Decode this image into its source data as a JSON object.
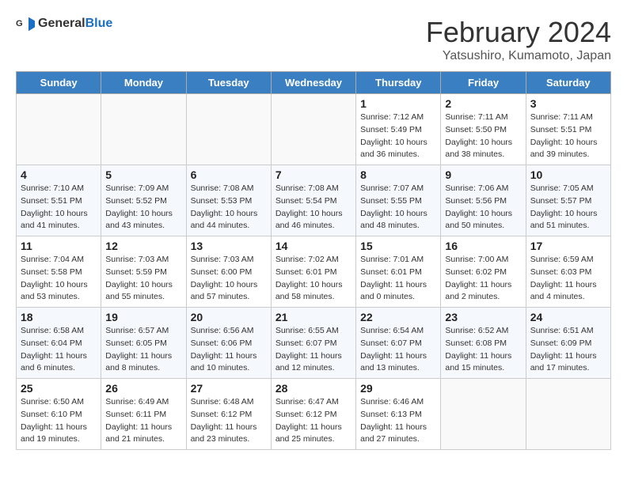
{
  "header": {
    "logo_general": "General",
    "logo_blue": "Blue",
    "title": "February 2024",
    "location": "Yatsushiro, Kumamoto, Japan"
  },
  "weekdays": [
    "Sunday",
    "Monday",
    "Tuesday",
    "Wednesday",
    "Thursday",
    "Friday",
    "Saturday"
  ],
  "weeks": [
    [
      {
        "day": "",
        "info": ""
      },
      {
        "day": "",
        "info": ""
      },
      {
        "day": "",
        "info": ""
      },
      {
        "day": "",
        "info": ""
      },
      {
        "day": "1",
        "info": "Sunrise: 7:12 AM\nSunset: 5:49 PM\nDaylight: 10 hours\nand 36 minutes."
      },
      {
        "day": "2",
        "info": "Sunrise: 7:11 AM\nSunset: 5:50 PM\nDaylight: 10 hours\nand 38 minutes."
      },
      {
        "day": "3",
        "info": "Sunrise: 7:11 AM\nSunset: 5:51 PM\nDaylight: 10 hours\nand 39 minutes."
      }
    ],
    [
      {
        "day": "4",
        "info": "Sunrise: 7:10 AM\nSunset: 5:51 PM\nDaylight: 10 hours\nand 41 minutes."
      },
      {
        "day": "5",
        "info": "Sunrise: 7:09 AM\nSunset: 5:52 PM\nDaylight: 10 hours\nand 43 minutes."
      },
      {
        "day": "6",
        "info": "Sunrise: 7:08 AM\nSunset: 5:53 PM\nDaylight: 10 hours\nand 44 minutes."
      },
      {
        "day": "7",
        "info": "Sunrise: 7:08 AM\nSunset: 5:54 PM\nDaylight: 10 hours\nand 46 minutes."
      },
      {
        "day": "8",
        "info": "Sunrise: 7:07 AM\nSunset: 5:55 PM\nDaylight: 10 hours\nand 48 minutes."
      },
      {
        "day": "9",
        "info": "Sunrise: 7:06 AM\nSunset: 5:56 PM\nDaylight: 10 hours\nand 50 minutes."
      },
      {
        "day": "10",
        "info": "Sunrise: 7:05 AM\nSunset: 5:57 PM\nDaylight: 10 hours\nand 51 minutes."
      }
    ],
    [
      {
        "day": "11",
        "info": "Sunrise: 7:04 AM\nSunset: 5:58 PM\nDaylight: 10 hours\nand 53 minutes."
      },
      {
        "day": "12",
        "info": "Sunrise: 7:03 AM\nSunset: 5:59 PM\nDaylight: 10 hours\nand 55 minutes."
      },
      {
        "day": "13",
        "info": "Sunrise: 7:03 AM\nSunset: 6:00 PM\nDaylight: 10 hours\nand 57 minutes."
      },
      {
        "day": "14",
        "info": "Sunrise: 7:02 AM\nSunset: 6:01 PM\nDaylight: 10 hours\nand 58 minutes."
      },
      {
        "day": "15",
        "info": "Sunrise: 7:01 AM\nSunset: 6:01 PM\nDaylight: 11 hours\nand 0 minutes."
      },
      {
        "day": "16",
        "info": "Sunrise: 7:00 AM\nSunset: 6:02 PM\nDaylight: 11 hours\nand 2 minutes."
      },
      {
        "day": "17",
        "info": "Sunrise: 6:59 AM\nSunset: 6:03 PM\nDaylight: 11 hours\nand 4 minutes."
      }
    ],
    [
      {
        "day": "18",
        "info": "Sunrise: 6:58 AM\nSunset: 6:04 PM\nDaylight: 11 hours\nand 6 minutes."
      },
      {
        "day": "19",
        "info": "Sunrise: 6:57 AM\nSunset: 6:05 PM\nDaylight: 11 hours\nand 8 minutes."
      },
      {
        "day": "20",
        "info": "Sunrise: 6:56 AM\nSunset: 6:06 PM\nDaylight: 11 hours\nand 10 minutes."
      },
      {
        "day": "21",
        "info": "Sunrise: 6:55 AM\nSunset: 6:07 PM\nDaylight: 11 hours\nand 12 minutes."
      },
      {
        "day": "22",
        "info": "Sunrise: 6:54 AM\nSunset: 6:07 PM\nDaylight: 11 hours\nand 13 minutes."
      },
      {
        "day": "23",
        "info": "Sunrise: 6:52 AM\nSunset: 6:08 PM\nDaylight: 11 hours\nand 15 minutes."
      },
      {
        "day": "24",
        "info": "Sunrise: 6:51 AM\nSunset: 6:09 PM\nDaylight: 11 hours\nand 17 minutes."
      }
    ],
    [
      {
        "day": "25",
        "info": "Sunrise: 6:50 AM\nSunset: 6:10 PM\nDaylight: 11 hours\nand 19 minutes."
      },
      {
        "day": "26",
        "info": "Sunrise: 6:49 AM\nSunset: 6:11 PM\nDaylight: 11 hours\nand 21 minutes."
      },
      {
        "day": "27",
        "info": "Sunrise: 6:48 AM\nSunset: 6:12 PM\nDaylight: 11 hours\nand 23 minutes."
      },
      {
        "day": "28",
        "info": "Sunrise: 6:47 AM\nSunset: 6:12 PM\nDaylight: 11 hours\nand 25 minutes."
      },
      {
        "day": "29",
        "info": "Sunrise: 6:46 AM\nSunset: 6:13 PM\nDaylight: 11 hours\nand 27 minutes."
      },
      {
        "day": "",
        "info": ""
      },
      {
        "day": "",
        "info": ""
      }
    ]
  ]
}
